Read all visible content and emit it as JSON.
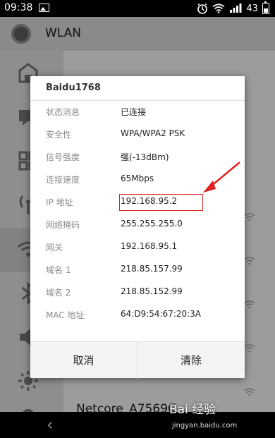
{
  "status_bar": {
    "time": "09:38",
    "battery": "43"
  },
  "app": {
    "title": "WLAN",
    "bottom_network": "Netcore_A7569C"
  },
  "dialog": {
    "title": "Baidu1768",
    "rows": [
      {
        "label": "状态消息",
        "value": "已连接"
      },
      {
        "label": "安全性",
        "value": "WPA/WPA2 PSK"
      },
      {
        "label": "信号强度",
        "value": "强(-13dBm)"
      },
      {
        "label": "连接速度",
        "value": "65Mbps"
      },
      {
        "label": "IP 地址",
        "value": "192.168.95.2"
      },
      {
        "label": "网络掩码",
        "value": "255.255.255.0"
      },
      {
        "label": "网关",
        "value": "192.168.95.1"
      },
      {
        "label": "域名 1",
        "value": "218.85.157.99"
      },
      {
        "label": "域名 2",
        "value": "218.85.152.99"
      },
      {
        "label": "MAC 地址",
        "value": "64:D9:54:67:20:3A"
      }
    ],
    "cancel_label": "取消",
    "clear_label": "清除"
  },
  "watermark": {
    "text": "Bai 经验",
    "url": "jingyan.baidu.com"
  },
  "icons": {
    "back": "back-chevron-icon",
    "settings": "gear-icon",
    "wifi": "wifi-icon"
  },
  "colors": {
    "highlight": "#e02020"
  }
}
